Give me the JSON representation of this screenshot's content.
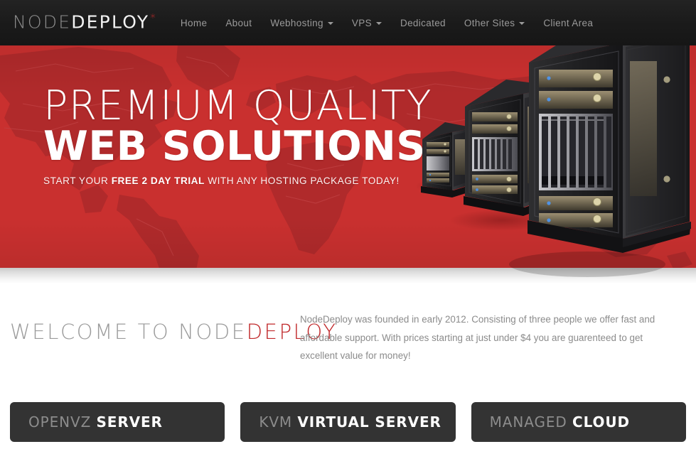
{
  "header": {
    "logo": {
      "part1": "NODE",
      "part2": "DEPLOY",
      "mark": "*"
    },
    "nav": [
      {
        "label": "Home",
        "dropdown": false
      },
      {
        "label": "About",
        "dropdown": false
      },
      {
        "label": "Webhosting",
        "dropdown": true
      },
      {
        "label": "VPS",
        "dropdown": true
      },
      {
        "label": "Dedicated",
        "dropdown": false
      },
      {
        "label": "Other Sites",
        "dropdown": true
      },
      {
        "label": "Client Area",
        "dropdown": false
      }
    ]
  },
  "hero": {
    "line1": "PREMIUM QUALITY",
    "line2": "WEB SOLUTIONS",
    "sub_pre": "START YOUR ",
    "sub_strong": "FREE 2 DAY TRIAL",
    "sub_post": " WITH ANY HOSTING PACKAGE TODAY!",
    "background_color": "#c9302f",
    "map_color": "#b02a2b"
  },
  "welcome": {
    "heading_gray": "WELCOME TO NODE",
    "heading_red": "DEPLOY",
    "body": "NodeDeploy was founded in early 2012. Consisting of three people we offer fast and affordable support. With prices starting at just under $4 you are guarenteed to get excellent value for money!"
  },
  "products": [
    {
      "prefix": "OPENVZ",
      "suffix": "SERVER"
    },
    {
      "prefix": "KVM",
      "suffix": "VIRTUAL SERVER"
    },
    {
      "prefix": "MANAGED",
      "suffix": "CLOUD"
    }
  ],
  "colors": {
    "header_bg": "#1b1b1b",
    "brand_red": "#c9302f",
    "accent_red": "#c0282a",
    "card_bg": "#333333",
    "body_text": "#8b8b8b"
  }
}
